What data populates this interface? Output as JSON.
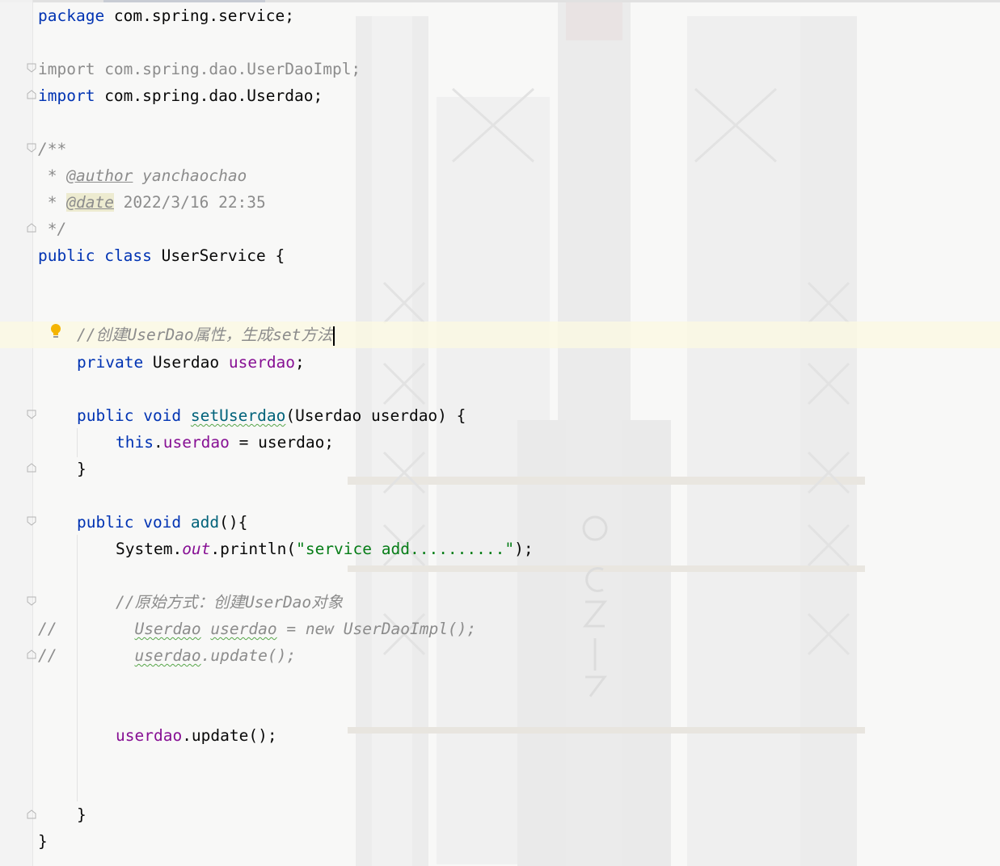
{
  "editor": {
    "language": "java",
    "lines": {
      "package": {
        "kw": "package",
        "rest": " com.spring.service;"
      },
      "import1": {
        "kw": "import",
        "rest": " com.spring.dao.UserDaoImpl;"
      },
      "import2": {
        "kw": "import",
        "rest": " com.spring.dao.Userdao;"
      },
      "doc_open": "/**",
      "doc_author_prefix": " * ",
      "doc_author_tag": "@author",
      "doc_author_value": " yanchaochao",
      "doc_date_prefix": " * ",
      "doc_date_tag": "@date",
      "doc_date_value": " 2022/3/16 22:35",
      "doc_close": " */",
      "class_decl": {
        "kw1": "public",
        "kw2": "class",
        "name": " UserService {"
      },
      "comment1": "//创建UserDao属性，生成set方法",
      "field_decl": {
        "kw": "private",
        "type": " Userdao ",
        "name": "userdao",
        "end": ";"
      },
      "setter_decl": {
        "kw1": "public",
        "kw2": "void",
        "method": "setUserdao",
        "params": "(Userdao userdao) {"
      },
      "setter_body": {
        "kw": "this",
        "dot": ".",
        "field": "userdao",
        "rest": " = userdao;"
      },
      "close_brace_method": "}",
      "add_decl": {
        "kw1": "public",
        "kw2": "void",
        "method": "add",
        "rest": "(){"
      },
      "println": {
        "a": "System.",
        "out": "out",
        "b": ".println(",
        "str": "\"service add..........\"",
        "c": ");"
      },
      "comment2": "//原始方式：创建UserDao对象",
      "commented1": {
        "prefix": "//",
        "a": "Userdao",
        "b": " ",
        "c": "userdao",
        "d": " = new UserDaoImpl();"
      },
      "commented2": {
        "prefix": "//",
        "a": "userdao",
        "b": ".update();"
      },
      "update_call": {
        "field": "userdao",
        "rest": ".update();"
      },
      "close_brace_add": "}",
      "close_brace_class": "}"
    },
    "caret_line": 13,
    "colors": {
      "keyword": "#0033b3",
      "field": "#871094",
      "method_decl": "#00627a",
      "string": "#067d17",
      "comment": "#8c8c8c",
      "caret_line_bg": "#fcfae1"
    },
    "icons": [
      "intention-bulb-icon",
      "fold-icon"
    ]
  }
}
